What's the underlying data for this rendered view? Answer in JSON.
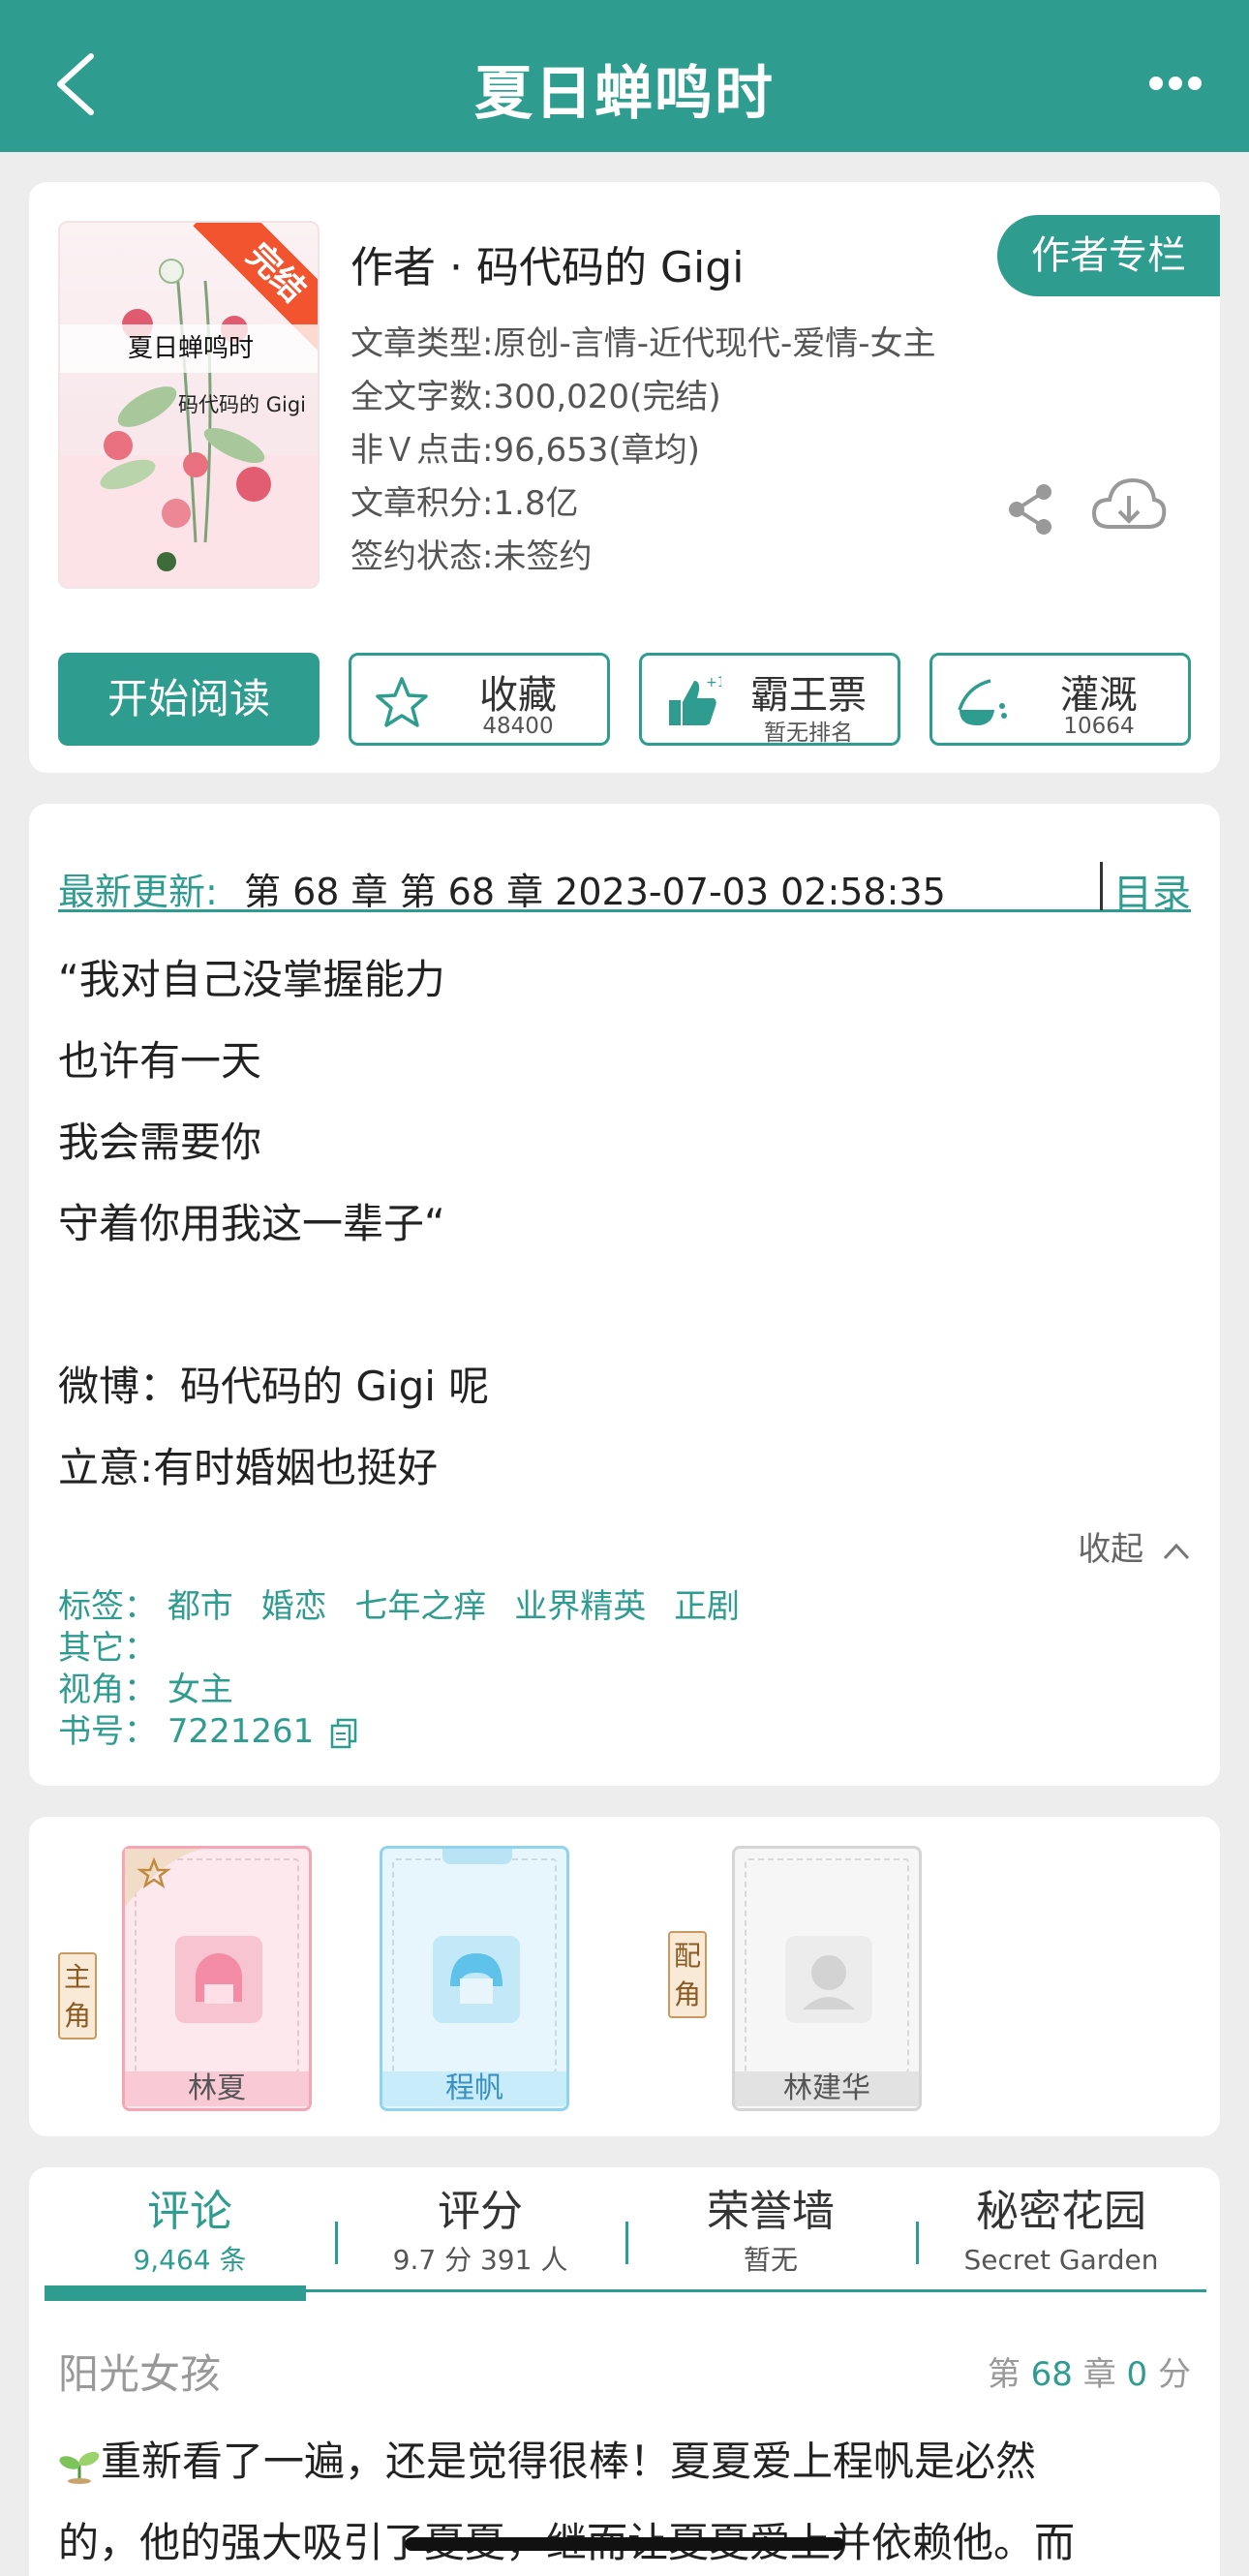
{
  "header": {
    "title": "夏日蝉鸣时"
  },
  "book": {
    "cover_title": "夏日蝉鸣时",
    "cover_author": "码代码的 Gigi",
    "cover_badge": "完结",
    "author_line": "作者 · 码代码的 Gigi",
    "author_button": "作者专栏",
    "meta": [
      "文章类型:原创-言情-近代现代-爱情-女主",
      "全文字数:300,020(完结)",
      "非Ｖ点击:96,653(章均)",
      "文章积分:1.8亿",
      "签约状态:未签约"
    ]
  },
  "actions": {
    "read": "开始阅读",
    "collect": {
      "label": "收藏",
      "sub": "48400"
    },
    "vote": {
      "label": "霸王票",
      "sub": "暂无排名"
    },
    "water": {
      "label": "灌溉",
      "sub": "10664"
    }
  },
  "update": {
    "label": "最新更新:",
    "value": "第 68 章 第 68 章 2023-07-03 02:58:35",
    "toc": "目录"
  },
  "description": [
    "“我对自己没掌握能力",
    "也许有一天",
    "我会需要你",
    "守着你用我这一辈子“",
    "",
    "微博：码代码的 Gigi 呢",
    "立意:有时婚姻也挺好"
  ],
  "collapse": "收起",
  "tags": {
    "tags_label": "标签：",
    "tags": [
      "都市",
      "婚恋",
      "七年之痒",
      "业界精英",
      "正剧"
    ],
    "other_label": "其它：",
    "view_label": "视角：",
    "view": "女主",
    "id_label": "书号：",
    "id": "7221261"
  },
  "characters": {
    "main_label": "主角",
    "support_label": "配角",
    "items": [
      "林夏",
      "程帆",
      "林建华"
    ]
  },
  "comments": {
    "tabs": [
      {
        "label": "评论",
        "sub": "9,464 条"
      },
      {
        "label": "评分",
        "sub": "9.7 分 391 人"
      },
      {
        "label": "荣誉墙",
        "sub": "暂无"
      },
      {
        "label": "秘密花园",
        "sub": "Secret Garden"
      }
    ],
    "user": "阳光女孩",
    "chap_pre": "第",
    "chap_num": "68",
    "chap_mid": "章",
    "score": "0",
    "score_unit": "分",
    "text_line1": "重新看了一遍，还是觉得很棒！夏夏爱上程帆是必然",
    "text_line2": "的，他的强大吸引了夏夏，继而让夏夏爱上并依赖他。而"
  },
  "colors": {
    "accent": "#2e9d8f",
    "badge": "#f1542f"
  }
}
